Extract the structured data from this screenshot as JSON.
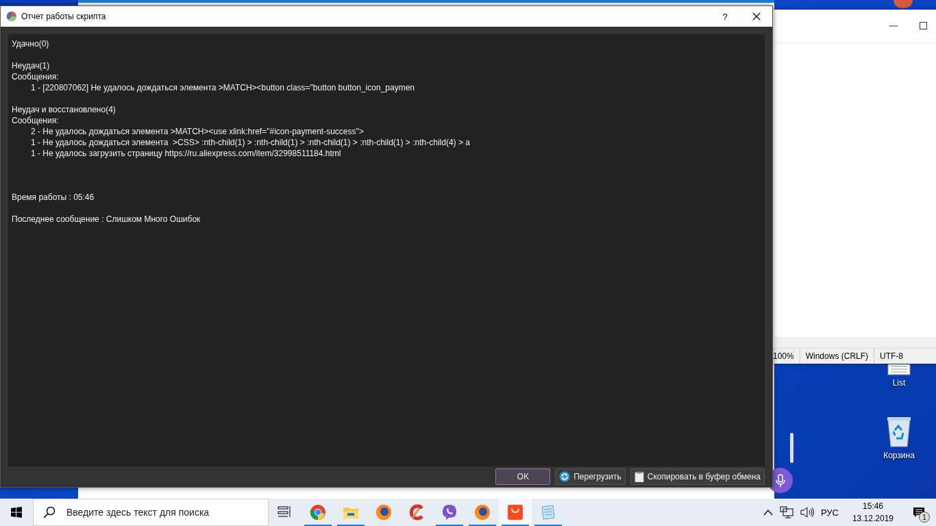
{
  "dialog": {
    "title": "Отчет работы скрипта",
    "help_button": "?",
    "report_lines": [
      {
        "kind": "text",
        "text": "Удачно(0)"
      },
      {
        "kind": "blank"
      },
      {
        "kind": "text",
        "text": "Неудач(1)"
      },
      {
        "kind": "text",
        "text": "Сообщения:"
      },
      {
        "kind": "message",
        "text": "1 - [220807062] Не удалось дождаться элемента >MATCH><button class=\"button button_icon_paymen"
      },
      {
        "kind": "blank"
      },
      {
        "kind": "text",
        "text": "Неудач и восстановлено(4)"
      },
      {
        "kind": "text",
        "text": "Сообщения:"
      },
      {
        "kind": "message",
        "text": "2 - Не удалось дождаться элемента >MATCH><use xlink:href=\"#icon-payment-success\">"
      },
      {
        "kind": "message",
        "text": "1 - Не удалось дождаться элемента  >CSS> :nth-child(1) > :nth-child(1) > :nth-child(1) > :nth-child(1) > :nth-child(4) > a"
      },
      {
        "kind": "message",
        "text": "1 - Не удалось загрузить страницу https://ru.aliexpress.com/item/32998511184.html"
      },
      {
        "kind": "blank"
      },
      {
        "kind": "blank"
      },
      {
        "kind": "blank"
      },
      {
        "kind": "text",
        "text": "Время работы : 05:46"
      },
      {
        "kind": "blank"
      },
      {
        "kind": "text",
        "text": "Последнее сообщение : Слишком Много Ошибок"
      }
    ],
    "buttons": [
      {
        "kind": "ok",
        "label": "OK"
      },
      {
        "kind": "reload",
        "label": "Перегрузить"
      },
      {
        "kind": "copy",
        "label": "Скопировать в буфер обмена"
      }
    ]
  },
  "notepad": {
    "status_bar": [
      "100%",
      "Windows (CRLF)",
      "UTF-8"
    ]
  },
  "desktop_icons": [
    {
      "kind": "document",
      "label": "List"
    },
    {
      "kind": "recycle",
      "label": "Корзина"
    }
  ],
  "taskbar": {
    "search": {
      "placeholder": "Введите здесь текст для поиска"
    },
    "apps": [
      {
        "kind": "taskview",
        "running": false,
        "selected": false
      },
      {
        "kind": "chrome",
        "running": true,
        "selected": false
      },
      {
        "kind": "explorer",
        "running": true,
        "selected": false
      },
      {
        "kind": "firefox",
        "running": false,
        "selected": false
      },
      {
        "kind": "ccleaner",
        "running": false,
        "selected": false
      },
      {
        "kind": "viber",
        "running": true,
        "selected": false
      },
      {
        "kind": "firefox",
        "running": true,
        "selected": false
      },
      {
        "kind": "aliexpress",
        "running": true,
        "selected": true
      },
      {
        "kind": "notepad",
        "running": true,
        "selected": false
      }
    ],
    "language": "РУС",
    "time": "15:46",
    "date": "13.12.2019",
    "notifications": "1"
  }
}
